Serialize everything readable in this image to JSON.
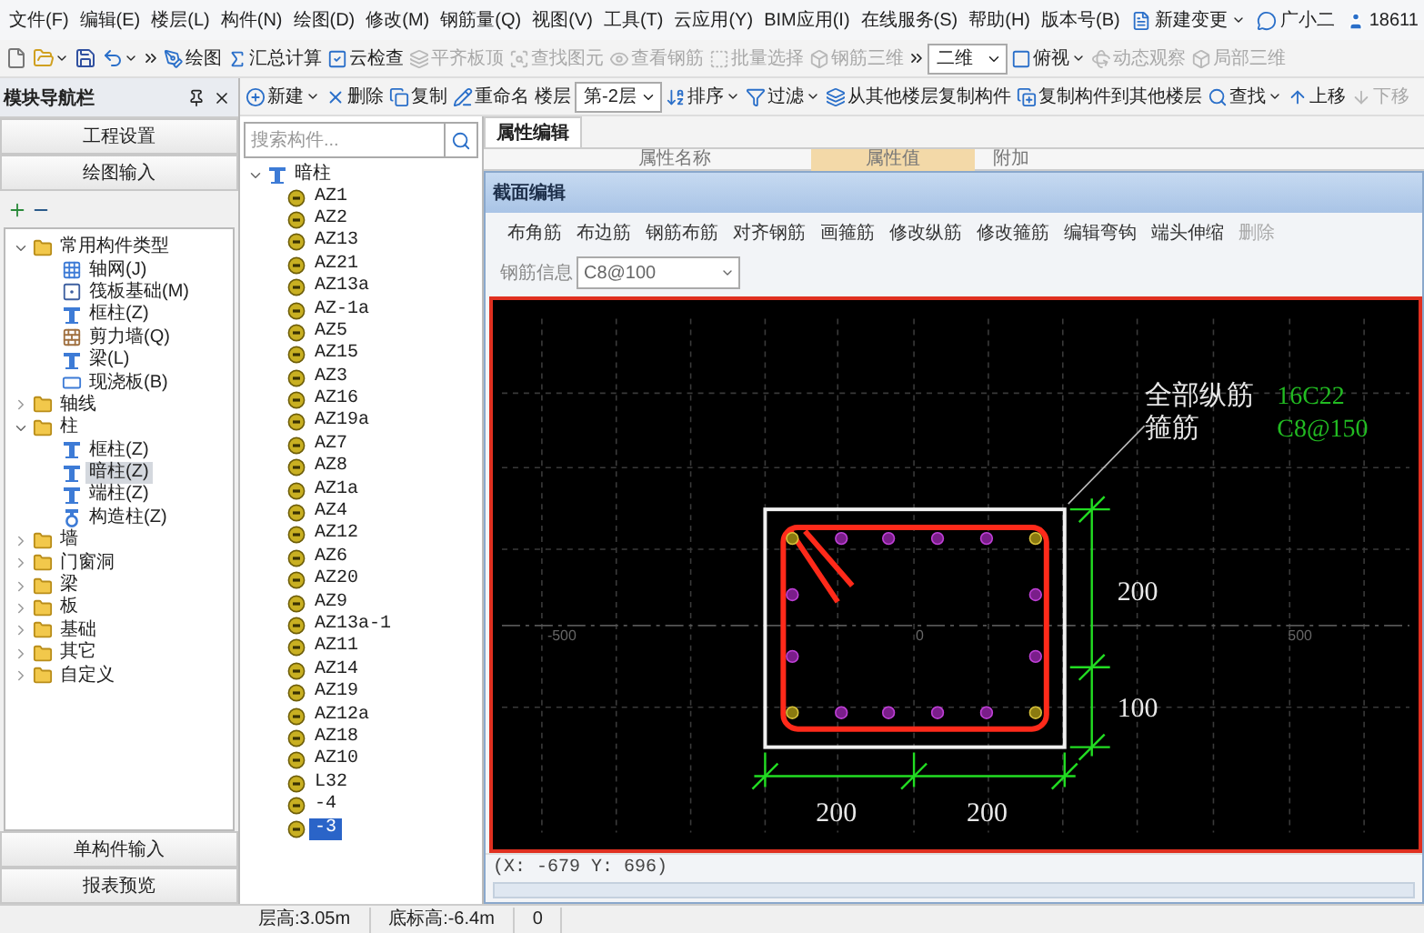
{
  "menu": [
    "文件(F)",
    "编辑(E)",
    "楼层(L)",
    "构件(N)",
    "绘图(D)",
    "修改(M)",
    "钢筋量(Q)",
    "视图(V)",
    "工具(T)",
    "云应用(Y)",
    "BIM应用(I)",
    "在线服务(S)",
    "帮助(H)",
    "版本号(B)"
  ],
  "menu_extras": {
    "new_change": "新建变更",
    "assistant": "广小二",
    "account": "18611"
  },
  "toolbar": [
    {
      "kind": "draw",
      "label": "绘图",
      "disabled": false,
      "dropdown": false
    },
    {
      "kind": "sum",
      "label": "汇总计算",
      "disabled": false,
      "dropdown": false
    },
    {
      "kind": "cloud",
      "label": "云检查",
      "disabled": false,
      "dropdown": false
    },
    {
      "kind": "align",
      "label": "平齐板顶",
      "disabled": true,
      "dropdown": false
    },
    {
      "kind": "find",
      "label": "查找图元",
      "disabled": true,
      "dropdown": false
    },
    {
      "kind": "rebar",
      "label": "查看钢筋",
      "disabled": true,
      "dropdown": false
    },
    {
      "kind": "batch",
      "label": "批量选择",
      "disabled": true,
      "dropdown": false
    },
    {
      "kind": "rebar3d",
      "label": "钢筋三维",
      "disabled": true,
      "dropdown": false
    },
    {
      "kind": "more"
    },
    {
      "kind": "select",
      "value": "二维"
    },
    {
      "kind": "top",
      "label": "俯视",
      "disabled": false,
      "dropdown": true
    },
    {
      "kind": "orbit",
      "label": "动态观察",
      "disabled": true,
      "dropdown": false
    },
    {
      "kind": "local3d",
      "label": "局部三维",
      "disabled": true,
      "dropdown": false
    }
  ],
  "nav": {
    "title": "模块导航栏",
    "sections": [
      "工程设置",
      "绘图输入"
    ],
    "tree": [
      {
        "label": "常用构件类型",
        "kind": "folder",
        "expanded": true,
        "selected": false,
        "children": [
          {
            "label": "轴网(J)",
            "kind": "grid",
            "selected": false
          },
          {
            "label": "筏板基础(M)",
            "kind": "raft",
            "selected": false
          },
          {
            "label": "框柱(Z)",
            "kind": "column",
            "selected": false
          },
          {
            "label": "剪力墙(Q)",
            "kind": "wall",
            "selected": false
          },
          {
            "label": "梁(L)",
            "kind": "column",
            "selected": false
          },
          {
            "label": "现浇板(B)",
            "kind": "slab",
            "selected": false
          }
        ]
      },
      {
        "label": "轴线",
        "kind": "folder",
        "expanded": false,
        "selected": false
      },
      {
        "label": "柱",
        "kind": "folder",
        "expanded": true,
        "selected": false,
        "children": [
          {
            "label": "框柱(Z)",
            "kind": "column",
            "selected": false
          },
          {
            "label": "暗柱(Z)",
            "kind": "column",
            "selected": true
          },
          {
            "label": "端柱(Z)",
            "kind": "column",
            "selected": false
          },
          {
            "label": "构造柱(Z)",
            "kind": "construct",
            "selected": false
          }
        ]
      },
      {
        "label": "墙",
        "kind": "folder",
        "expanded": false,
        "selected": false
      },
      {
        "label": "门窗洞",
        "kind": "folder",
        "expanded": false,
        "selected": false
      },
      {
        "label": "梁",
        "kind": "folder",
        "expanded": false,
        "selected": false
      },
      {
        "label": "板",
        "kind": "folder",
        "expanded": false,
        "selected": false
      },
      {
        "label": "基础",
        "kind": "folder",
        "expanded": false,
        "selected": false
      },
      {
        "label": "其它",
        "kind": "folder",
        "expanded": false,
        "selected": false
      },
      {
        "label": "自定义",
        "kind": "folder",
        "expanded": false,
        "selected": false
      }
    ],
    "bottom_sections": [
      "单构件输入",
      "报表预览"
    ]
  },
  "component_toolbar": [
    {
      "kind": "new",
      "label": "新建",
      "disabled": false,
      "dropdown": true
    },
    {
      "kind": "delete",
      "label": "删除",
      "disabled": false,
      "dropdown": false
    },
    {
      "kind": "copy",
      "label": "复制",
      "disabled": false,
      "dropdown": false
    },
    {
      "kind": "rename",
      "label": "重命名",
      "disabled": false,
      "dropdown": false
    },
    {
      "kind": "label",
      "label": "楼层"
    },
    {
      "kind": "select",
      "value": "第-2层"
    },
    {
      "kind": "sort",
      "label": "排序",
      "disabled": false,
      "dropdown": true
    },
    {
      "kind": "filter",
      "label": "过滤",
      "disabled": false,
      "dropdown": true
    },
    {
      "kind": "copyfrom",
      "label": "从其他楼层复制构件",
      "disabled": false,
      "dropdown": false
    },
    {
      "kind": "copyto",
      "label": "复制构件到其他楼层",
      "disabled": false,
      "dropdown": false
    },
    {
      "kind": "search",
      "label": "查找",
      "disabled": false,
      "dropdown": true
    },
    {
      "kind": "up",
      "label": "上移",
      "disabled": false,
      "dropdown": false
    },
    {
      "kind": "down",
      "label": "下移",
      "disabled": true,
      "dropdown": false
    }
  ],
  "components": {
    "search": {
      "placeholder": "搜索构件..."
    },
    "tree": [
      {
        "label": "暗柱",
        "expanded": true,
        "selected": false,
        "children": [
          {
            "label": "AZ1",
            "selected": false
          },
          {
            "label": "AZ2",
            "selected": false
          },
          {
            "label": "AZ13",
            "selected": false
          },
          {
            "label": "AZ21",
            "selected": false
          },
          {
            "label": "AZ13a",
            "selected": false
          },
          {
            "label": "AZ-1a",
            "selected": false
          },
          {
            "label": "AZ5",
            "selected": false
          },
          {
            "label": "AZ15",
            "selected": false
          },
          {
            "label": "AZ3",
            "selected": false
          },
          {
            "label": "AZ16",
            "selected": false
          },
          {
            "label": "AZ19a",
            "selected": false
          },
          {
            "label": "AZ7",
            "selected": false
          },
          {
            "label": "AZ8",
            "selected": false
          },
          {
            "label": "AZ1a",
            "selected": false
          },
          {
            "label": "AZ4",
            "selected": false
          },
          {
            "label": "AZ12",
            "selected": false
          },
          {
            "label": "AZ6",
            "selected": false
          },
          {
            "label": "AZ20",
            "selected": false
          },
          {
            "label": "AZ9",
            "selected": false
          },
          {
            "label": "AZ13a-1",
            "selected": false
          },
          {
            "label": "AZ11",
            "selected": false
          },
          {
            "label": "AZ14",
            "selected": false
          },
          {
            "label": "AZ19",
            "selected": false
          },
          {
            "label": "AZ12a",
            "selected": false
          },
          {
            "label": "AZ18",
            "selected": false
          },
          {
            "label": "AZ10",
            "selected": false
          },
          {
            "label": "L32",
            "selected": false
          },
          {
            "label": "-4",
            "selected": false
          },
          {
            "label": "-3",
            "selected": true
          }
        ]
      }
    ]
  },
  "properties": {
    "tabs": [
      {
        "label": "属性编辑",
        "selected": true
      }
    ],
    "columns": [
      "属性名称",
      "属性值",
      "附加"
    ]
  },
  "dialog": {
    "title": "截面编辑",
    "tools": [
      {
        "label": "布角筋",
        "disabled": false
      },
      {
        "label": "布边筋",
        "disabled": false
      },
      {
        "label": "钢筋布筋",
        "disabled": false
      },
      {
        "label": "对齐钢筋",
        "disabled": false
      },
      {
        "label": "画箍筋",
        "disabled": false
      },
      {
        "label": "修改纵筋",
        "disabled": false
      },
      {
        "label": "修改箍筋",
        "disabled": false
      },
      {
        "label": "编辑弯钩",
        "disabled": false
      },
      {
        "label": "端头伸缩",
        "disabled": false
      },
      {
        "label": "删除",
        "disabled": true
      }
    ],
    "rebar_info": {
      "label": "钢筋信息",
      "value": "C8@100"
    },
    "canvas": {
      "axis_labels": [
        "-500",
        "0",
        "500"
      ],
      "right_dimensions": [
        "200",
        "100"
      ],
      "bottom_dimensions": [
        "200",
        "200"
      ],
      "callouts": [
        {
          "label": "全部纵筋",
          "value": "16C22"
        },
        {
          "label": "箍筋",
          "value": "C8@150"
        }
      ]
    },
    "coordinates": "(X: -679 Y: 696)"
  },
  "status_bar": [
    "层高:3.05m",
    "底标高:-6.4m",
    "0"
  ]
}
